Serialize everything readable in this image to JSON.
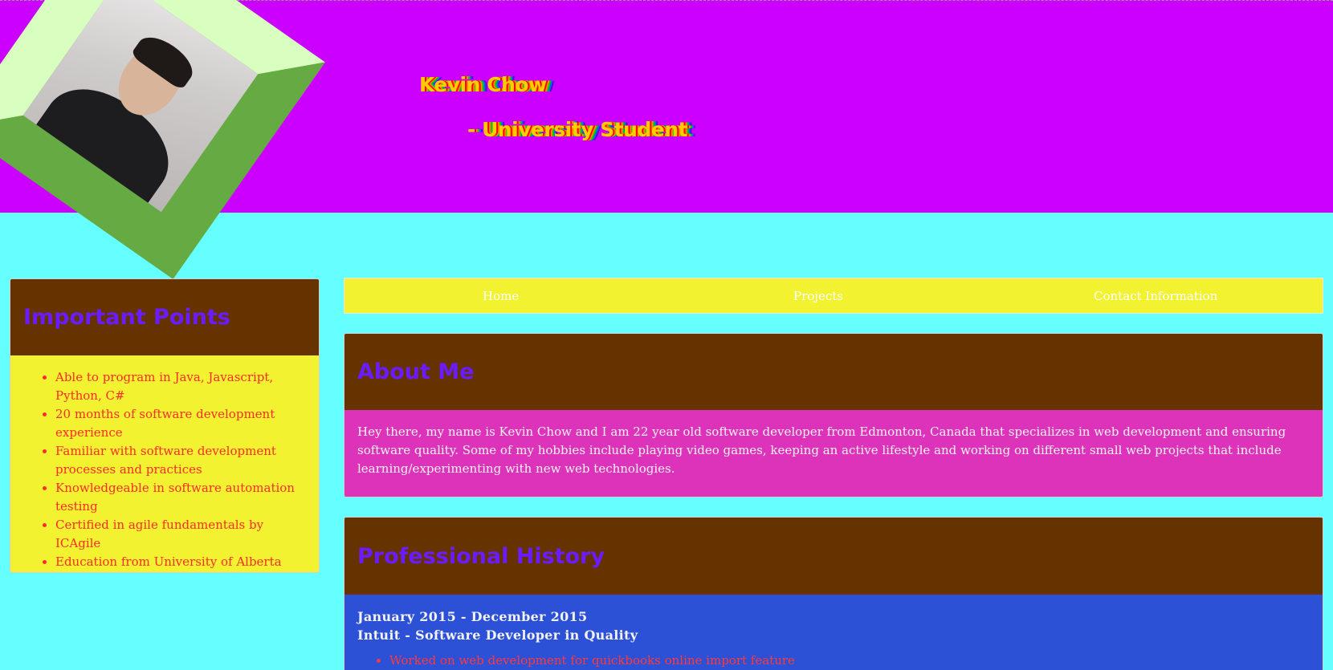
{
  "header": {
    "name": "Kevin Chow",
    "role": "- University Student",
    "avatar_alt": "profile photo",
    "background_color": "#cc00ff"
  },
  "important_points": {
    "title": "Important Points",
    "items": [
      "Able to program in Java, Javascript, Python, C#",
      "20 months of software development experience",
      "Familiar with software development processes and practices",
      "Knowledgeable in software automation testing",
      "Certified in agile fundamentals by ICAgile",
      "Education from University of Alberta"
    ]
  },
  "nav": {
    "items": [
      "Home",
      "Projects",
      "Contact Information"
    ]
  },
  "about": {
    "title": "About Me",
    "text": "Hey there, my name is Kevin Chow and I am 22 year old software developer from Edmonton, Canada that specializes in web development and ensuring software quality. Some of my hobbies include playing video games, keeping an active lifestyle and working on different small web projects that include learning/experimenting with new web technologies."
  },
  "history": {
    "title": "Professional History",
    "jobs": [
      {
        "dates": "January 2015 - December 2015",
        "position": "Intuit - Software Developer in Quality",
        "bullets": [
          "Worked on web development for quickbooks online import feature"
        ]
      }
    ]
  },
  "colors": {
    "page_background": "#66ffff",
    "panel_header": "#663300",
    "panel_title": "#6a1cff",
    "nav_background": "#f2f230",
    "about_background": "#dd33bb",
    "history_background": "#2c50d6",
    "list_text": "#ff2a2a"
  }
}
